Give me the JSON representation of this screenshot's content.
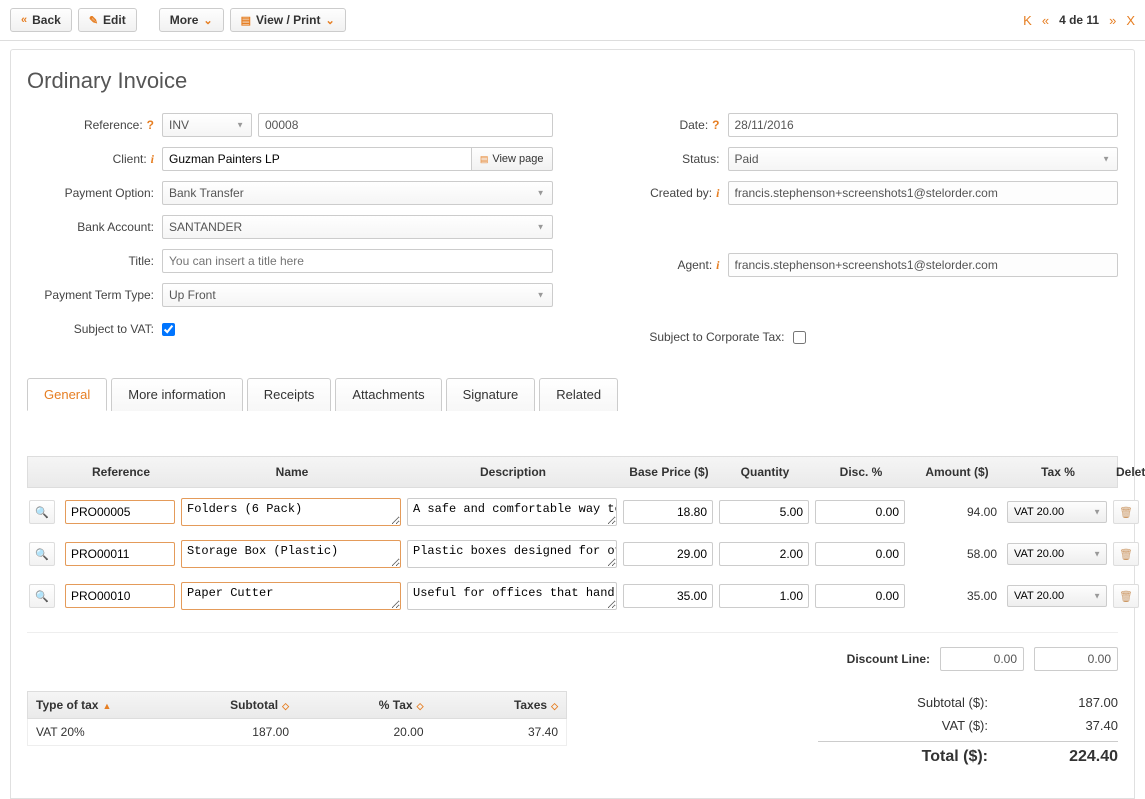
{
  "toolbar": {
    "back": "Back",
    "edit": "Edit",
    "more": "More",
    "view_print": "View / Print",
    "pager": "4 de 11"
  },
  "title": "Ordinary Invoice",
  "left_labels": {
    "reference": "Reference:",
    "client": "Client:",
    "payment_option": "Payment Option:",
    "bank_account": "Bank Account:",
    "title": "Title:",
    "payment_term": "Payment Term Type:",
    "subject_vat": "Subject to VAT:"
  },
  "right_labels": {
    "date": "Date:",
    "status": "Status:",
    "created_by": "Created by:",
    "agent": "Agent:",
    "subject_corp": "Subject to Corporate Tax:"
  },
  "form": {
    "ref_prefix": "INV",
    "ref_number": "00008",
    "client": "Guzman Painters LP",
    "view_page": "View page",
    "payment_option": "Bank Transfer",
    "bank_account": "SANTANDER",
    "title_placeholder": "You can insert a title here",
    "payment_term": "Up Front",
    "date": "28/11/2016",
    "status": "Paid",
    "created_by": "francis.stephenson+screenshots1@stelorder.com",
    "agent": "francis.stephenson+screenshots1@stelorder.com"
  },
  "tabs": [
    "General",
    "More information",
    "Receipts",
    "Attachments",
    "Signature",
    "Related"
  ],
  "items_header": {
    "reference": "Reference",
    "name": "Name",
    "description": "Description",
    "base_price": "Base Price ($)",
    "quantity": "Quantity",
    "disc": "Disc. %",
    "amount": "Amount ($)",
    "tax": "Tax %",
    "delete": "Delete"
  },
  "items": [
    {
      "ref": "PRO00005",
      "name": "Folders (6 Pack)",
      "desc": "A safe and comfortable way to store",
      "price": "18.80",
      "qty": "5.00",
      "disc": "0.00",
      "amount": "94.00",
      "tax": "VAT 20.00"
    },
    {
      "ref": "PRO00011",
      "name": "Storage Box (Plastic)",
      "desc": "Plastic boxes designed for offices,",
      "price": "29.00",
      "qty": "2.00",
      "disc": "0.00",
      "amount": "58.00",
      "tax": "VAT 20.00"
    },
    {
      "ref": "PRO00010",
      "name": "Paper Cutter",
      "desc": "Useful for offices that handle large",
      "price": "35.00",
      "qty": "1.00",
      "disc": "0.00",
      "amount": "35.00",
      "tax": "VAT 20.00"
    }
  ],
  "discount_label": "Discount Line:",
  "discount_values": [
    "0.00",
    "0.00"
  ],
  "tax_header": {
    "type": "Type of tax",
    "subtotal": "Subtotal",
    "pct": "% Tax",
    "taxes": "Taxes"
  },
  "tax_row": {
    "type": "VAT 20%",
    "subtotal": "187.00",
    "pct": "20.00",
    "taxes": "37.40"
  },
  "totals": {
    "subtotal_label": "Subtotal ($):",
    "subtotal": "187.00",
    "vat_label": "VAT ($):",
    "vat": "37.40",
    "total_label": "Total ($):",
    "total": "224.40"
  }
}
